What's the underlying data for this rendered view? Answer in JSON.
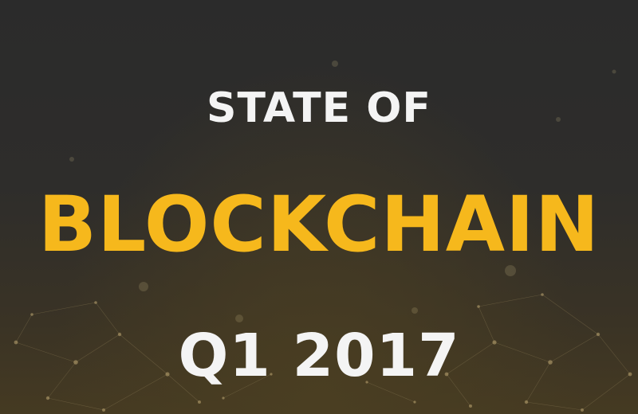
{
  "title": {
    "line1": "STATE OF",
    "line2": "BLOCKCHAIN",
    "line3": "Q1 2017"
  },
  "colors": {
    "background": "#2a2a2a",
    "accent": "#f6b81c",
    "text": "#f4f4f4"
  }
}
